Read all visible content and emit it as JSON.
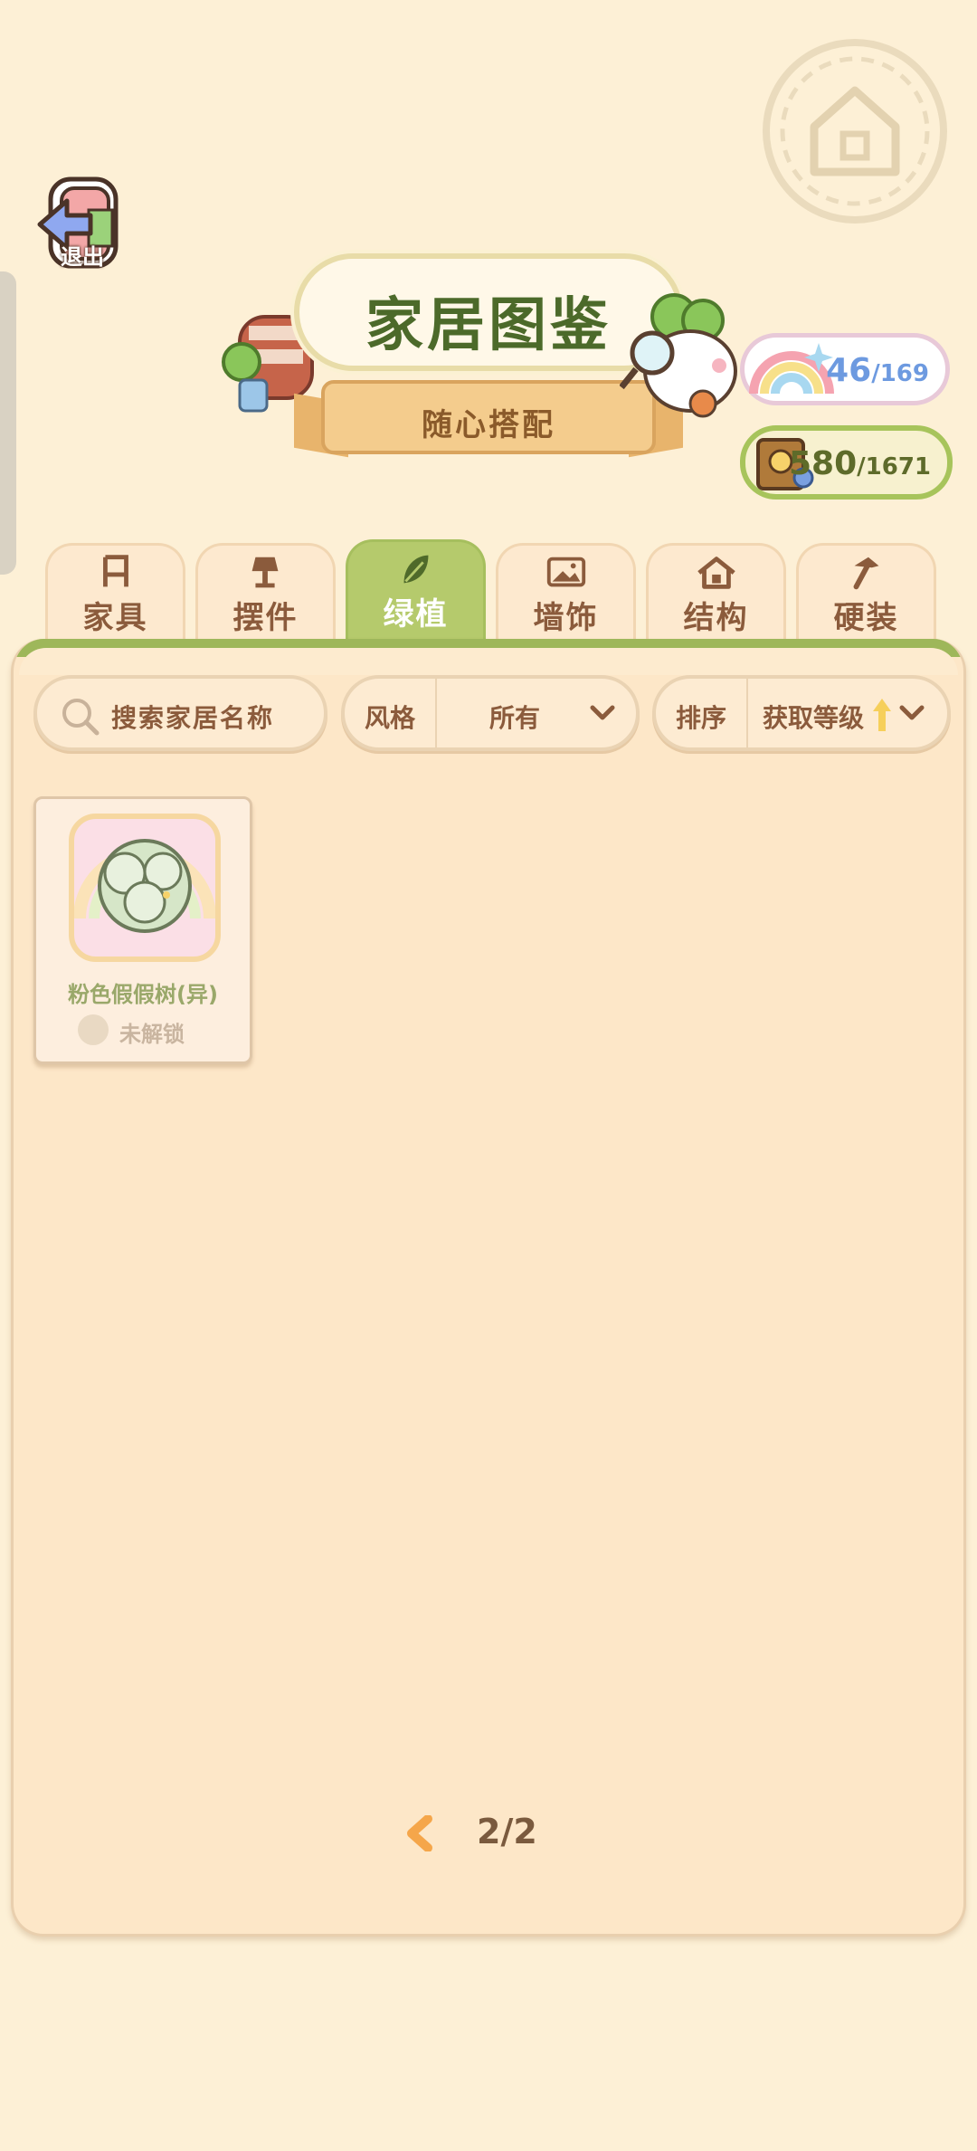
{
  "header": {
    "exit_label": "退出",
    "title": "家居图鉴",
    "subtitle": "随心搭配"
  },
  "counters": {
    "rainbow": {
      "value": "46",
      "total": "/169",
      "icon": "rainbow-icon"
    },
    "book": {
      "value": "580",
      "total": "/1671",
      "icon": "book-icon"
    }
  },
  "tabs": [
    {
      "label": "家具",
      "icon": "chair-icon",
      "active": false
    },
    {
      "label": "摆件",
      "icon": "lamp-icon",
      "active": false
    },
    {
      "label": "绿植",
      "icon": "leaf-icon",
      "active": true
    },
    {
      "label": "墙饰",
      "icon": "picture-icon",
      "active": false
    },
    {
      "label": "结构",
      "icon": "house-icon",
      "active": false
    },
    {
      "label": "硬装",
      "icon": "hammer-icon",
      "active": false
    }
  ],
  "filters": {
    "search_placeholder": "搜索家居名称",
    "style_key": "风格",
    "style_value": "所有",
    "sort_key": "排序",
    "sort_value": "获取等级"
  },
  "items": [
    {
      "name": "粉色假假树(异)",
      "status": "未解锁"
    }
  ],
  "pagination": {
    "text": "2/2"
  },
  "colors": {
    "accent_green": "#b5ca6c",
    "text_brown": "#8b5b3c",
    "background": "#fdf0d6"
  }
}
